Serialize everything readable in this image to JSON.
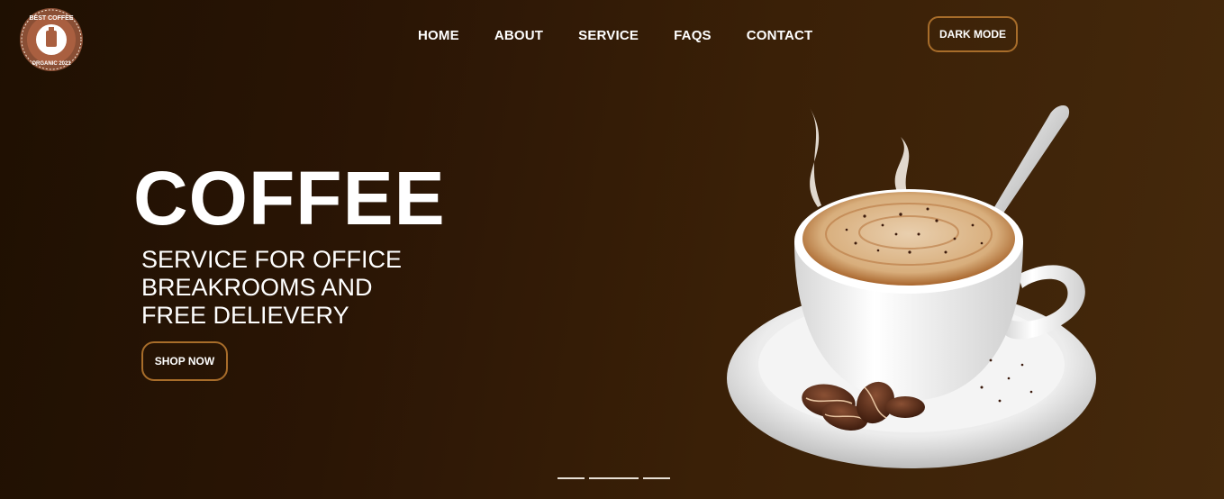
{
  "brand": {
    "logo_ring_text": "BEST COFFEE",
    "logo_bottom_text": "ORGANIC 2021"
  },
  "nav": {
    "items": [
      "HOME",
      "ABOUT",
      "SERVICE",
      "FAQS",
      "CONTACT"
    ]
  },
  "header": {
    "dark_mode_label": "DARK MODE"
  },
  "hero": {
    "title": "COFFEE",
    "subtitle_lines": [
      "SERVICE FOR OFFICE",
      "BREAKROOMS AND",
      "FREE DELIEVERY"
    ],
    "cta_label": "SHOP NOW"
  },
  "carousel": {
    "slide_count": 3
  },
  "colors": {
    "accent": "#a86d2a",
    "background_dark": "#1f1002",
    "background_light": "#45290c"
  }
}
